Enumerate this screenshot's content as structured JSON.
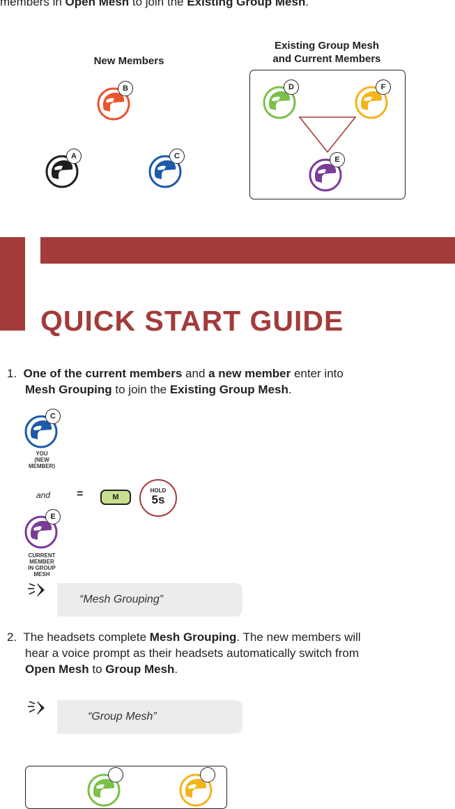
{
  "intro": {
    "pre": "members in ",
    "b1": "Open Mesh",
    "mid": " to join the ",
    "b2": "Existing Group Mesh",
    "post": "."
  },
  "diagram": {
    "new_members_title": "New Members",
    "existing_title_line1": "Existing Group Mesh",
    "existing_title_line2": "and Current Members",
    "helmets": [
      {
        "id": "A",
        "color": "#1f1f1f"
      },
      {
        "id": "B",
        "color": "#e9542f"
      },
      {
        "id": "C",
        "color": "#1d5aa8"
      },
      {
        "id": "D",
        "color": "#7cc049"
      },
      {
        "id": "E",
        "color": "#7a3c98"
      },
      {
        "id": "F",
        "color": "#f2b51c"
      }
    ],
    "connector_color": "#a23b3a"
  },
  "banner": {
    "title": "QUICK START GUIDE",
    "accent_color": "#a23b3a"
  },
  "step1": {
    "number": "1.",
    "b1": "One of the current members",
    "t1": " and ",
    "b2": "a new member",
    "t2": " enter into",
    "b3": "Mesh Grouping",
    "t3": " to join the ",
    "b4": "Existing Group Mesh",
    "t4": ".",
    "you_label": "YOU (NEW MEMBER)",
    "you_label_l1": "YOU",
    "you_label_l2": "(NEW",
    "you_label_l3": "MEMBER)",
    "and_text": "and",
    "equals": "=",
    "button_label": "M",
    "hold_label": "HOLD",
    "hold_value": "5s",
    "current_l1": "CURRENT",
    "current_l2": "MEMBER",
    "current_l3": "IN GROUP",
    "current_l4": "MESH",
    "voice_prompt": "“Mesh Grouping”"
  },
  "step2": {
    "number": "2.",
    "t1": "The headsets complete ",
    "b1": "Mesh Grouping",
    "t2": ". The new members will",
    "line2": "hear a voice prompt as their headsets automatically switch from",
    "b2": "Open Mesh",
    "t3": " to ",
    "b3": "Group Mesh",
    "t4": ".",
    "voice_prompt": "“Group Mesh”"
  }
}
